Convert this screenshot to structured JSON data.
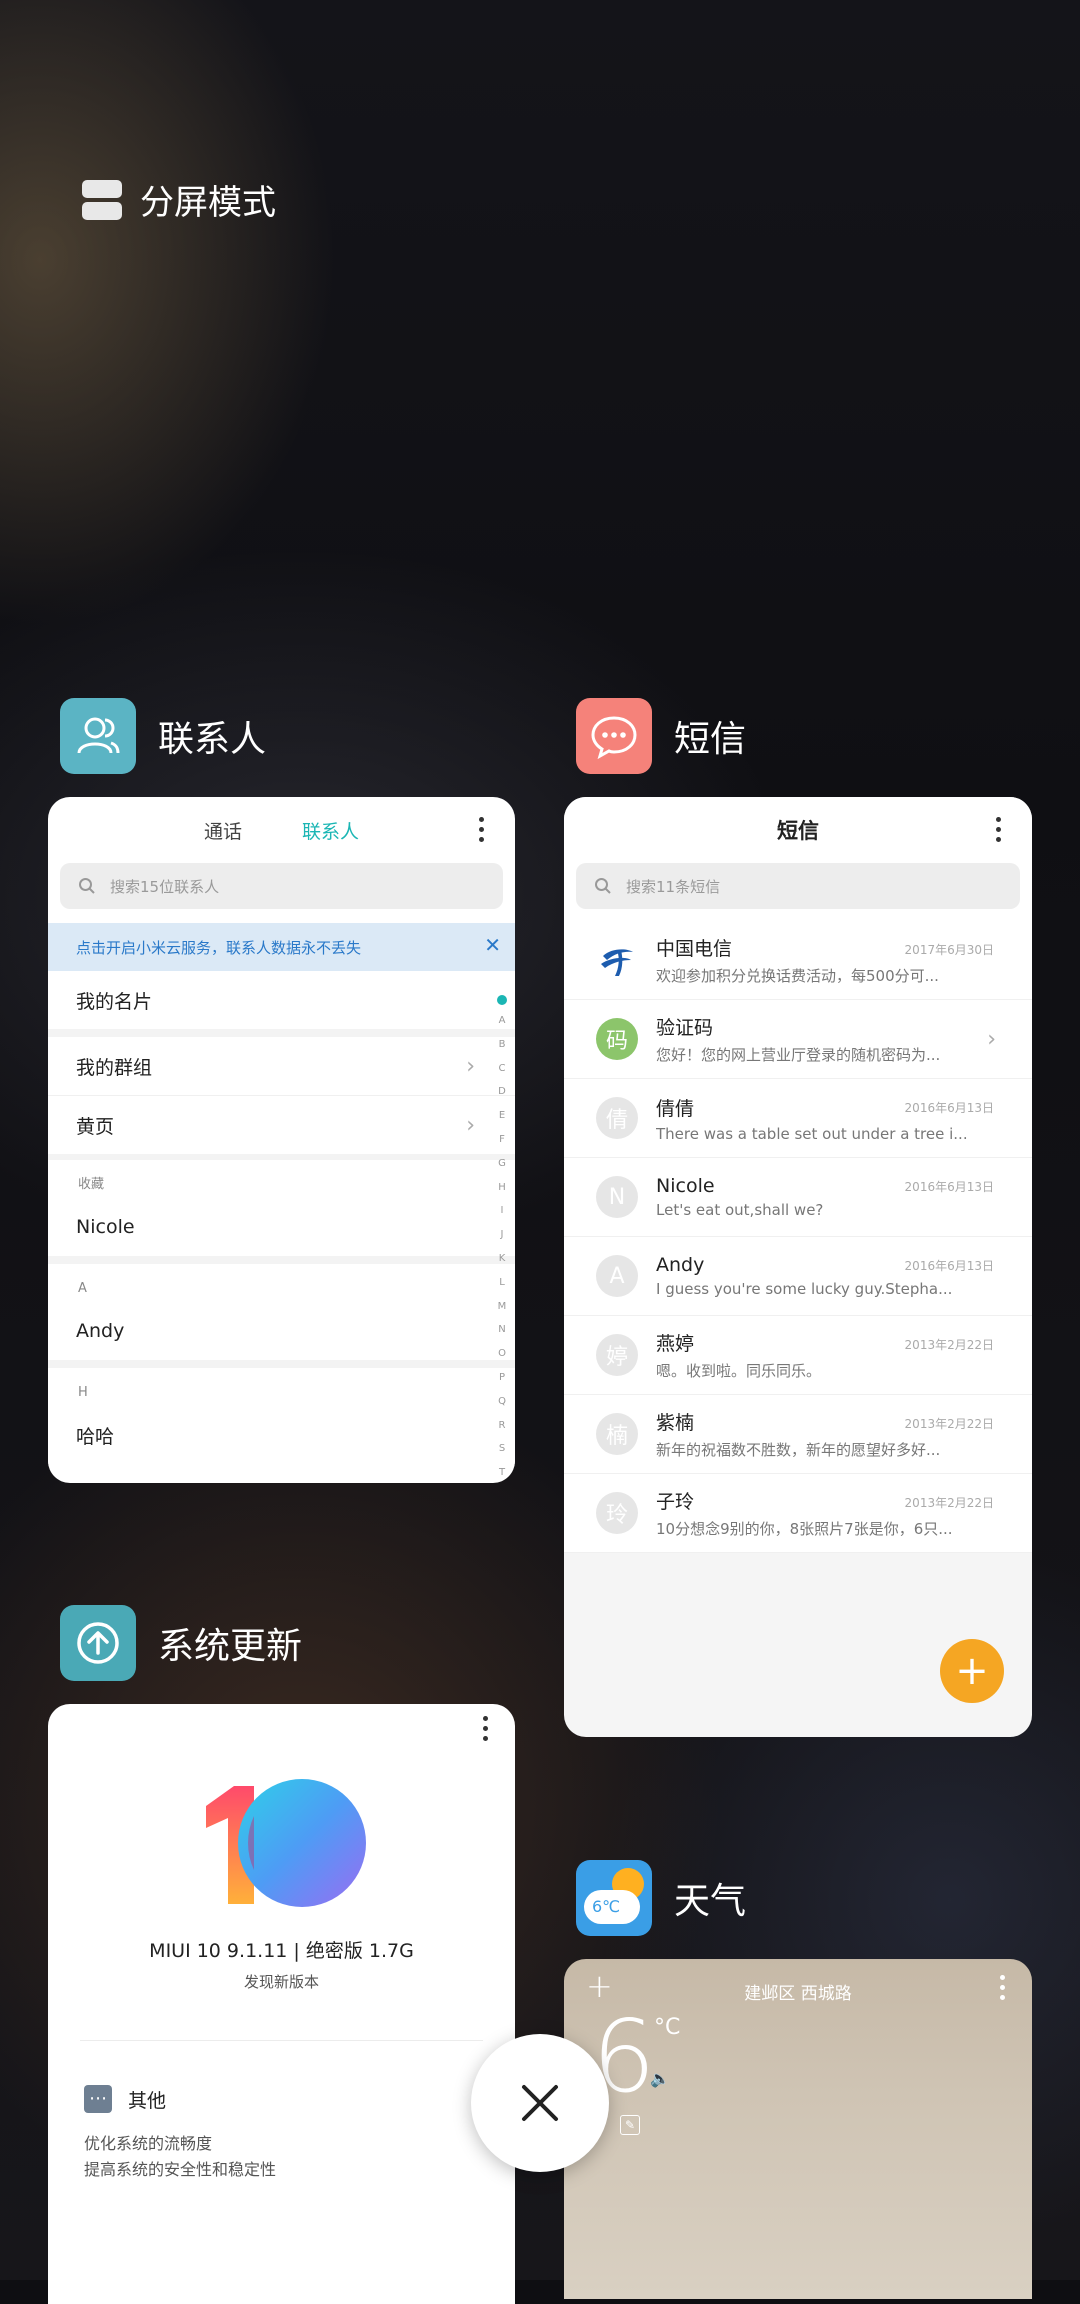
{
  "split_mode": {
    "label": "分屏模式"
  },
  "apps": {
    "contacts": {
      "name": "联系人",
      "tabs": [
        "通话",
        "联系人"
      ],
      "search_placeholder": "搜索15位联系人",
      "banner": "点击开启小米云服务，联系人数据永不丢失",
      "rows": {
        "my_card": "我的名片",
        "my_groups": "我的群组",
        "yellow_pages": "黄页"
      },
      "sections": [
        {
          "header": "收藏",
          "item": "Nicole"
        },
        {
          "header": "A",
          "item": "Andy"
        },
        {
          "header": "H",
          "item": "哈哈"
        }
      ],
      "alphabet": [
        "A",
        "B",
        "C",
        "D",
        "E",
        "F",
        "G",
        "H",
        "I",
        "J",
        "K",
        "L",
        "M",
        "N",
        "O",
        "P",
        "Q",
        "R",
        "S",
        "T"
      ]
    },
    "messages": {
      "name": "短信",
      "title": "短信",
      "search_placeholder": "搜索11条短信",
      "items": [
        {
          "avatar": "",
          "name": "中国电信",
          "text": "欢迎参加积分兑换话费活动，每500分可...",
          "date": "2017年6月30日"
        },
        {
          "avatar": "码",
          "name": "验证码",
          "text": "您好！您的网上营业厅登录的随机密码为...",
          "date": ""
        },
        {
          "avatar": "倩",
          "name": "倩倩",
          "text": "There was a table set out under a tree i...",
          "date": "2016年6月13日"
        },
        {
          "avatar": "N",
          "name": "Nicole",
          "text": "Let's eat out,shall we?",
          "date": "2016年6月13日"
        },
        {
          "avatar": "A",
          "name": "Andy",
          "text": "I guess you're some lucky guy.Stepha...",
          "date": "2016年6月13日"
        },
        {
          "avatar": "婷",
          "name": "燕婷",
          "text": "嗯。收到啦。同乐同乐。",
          "date": "2013年2月22日"
        },
        {
          "avatar": "楠",
          "name": "紫楠",
          "text": "新年的祝福数不胜数，新年的愿望好多好...",
          "date": "2013年2月22日"
        },
        {
          "avatar": "玲",
          "name": "子玲",
          "text": "10分想念9别的你，8张照片7张是你，6只...",
          "date": "2013年2月22日"
        }
      ]
    },
    "updater": {
      "name": "系统更新",
      "version": "MIUI 10 9.1.11 | 绝密版 1.7G",
      "status": "发现新版本",
      "section_title": "其他",
      "notes": [
        "优化系统的流畅度",
        "提高系统的安全性和稳定性"
      ]
    },
    "weather": {
      "name": "天气",
      "icon_temp": "6℃",
      "location": "建邺区 西城路",
      "temp": "6",
      "unit": "°C"
    }
  },
  "colors": {
    "accent_teal": "#1bb6b4",
    "sms_icon": "#f5827a",
    "fab": "#f5a623",
    "contacts_icon": "#5bb4c4",
    "updater_icon": "#4aa9b6"
  }
}
